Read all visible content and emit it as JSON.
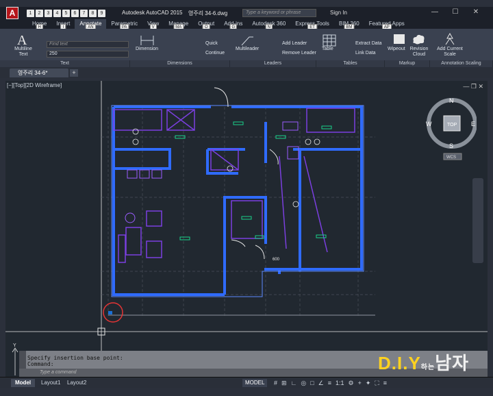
{
  "titlebar": {
    "logo": "A",
    "qat": [
      "1",
      "2",
      "3",
      "4",
      "5",
      "6",
      "7",
      "8",
      "9"
    ],
    "app_title": "Autodesk AutoCAD 2015",
    "file_name": "영주리 34-6.dwg",
    "search_placeholder": "Type a keyword or phrase",
    "signin": "Sign In",
    "minimize": "—",
    "maximize": "☐",
    "close": "✕"
  },
  "ribbon_tabs": [
    {
      "label": "Home",
      "key": "H"
    },
    {
      "label": "Insert",
      "key": "I"
    },
    {
      "label": "Annotate",
      "key": "AN"
    },
    {
      "label": "Parametric",
      "key": "PA"
    },
    {
      "label": "View",
      "key": "V"
    },
    {
      "label": "Manage",
      "key": "MA"
    },
    {
      "label": "Output",
      "key": "O"
    },
    {
      "label": "Add-ins",
      "key": "G"
    },
    {
      "label": "Autodesk 360",
      "key": "N"
    },
    {
      "label": "Express Tools",
      "key": "ET"
    },
    {
      "label": "BIM 360",
      "key": "BM"
    },
    {
      "label": "Featured Apps",
      "key": "AP"
    }
  ],
  "ribbon": {
    "multiline_text": "Multiline Text",
    "find_text_placeholder": "Find text",
    "text_height": "250",
    "dimension": "Dimension",
    "quick": "Quick",
    "continue": "Continue",
    "multileader": "Multileader",
    "add_leader": "Add Leader",
    "remove_leader": "Remove Leader",
    "table": "Table",
    "extract_data": "Extract Data",
    "link_data": "Link Data",
    "wipeout": "Wipeout",
    "revision_cloud": "Revision Cloud",
    "add_current_scale": "Add Current Scale",
    "panels": [
      "Text",
      "Dimensions",
      "Leaders",
      "Tables",
      "Markup",
      "Annotation Scaling"
    ]
  },
  "doc_tab": "영주리 34-6*",
  "viewport_label": "[−][Top][2D Wireframe]",
  "viewcube": {
    "top": "TOP",
    "n": "N",
    "s": "S",
    "e": "E",
    "w": "W",
    "wcs": "WCS"
  },
  "dimension_text": "600",
  "ucs_y": "Y",
  "command": {
    "history": [
      "Specify insertion base point:",
      "Command:"
    ],
    "placeholder": "Type a command"
  },
  "status": {
    "tabs": [
      "Model",
      "Layout1",
      "Layout2"
    ],
    "model_button": "MODEL",
    "scale": "1:1"
  },
  "watermark": {
    "dot": "D.I.Y",
    "mid": "하는",
    "end": "남자"
  },
  "colors": {
    "accent": "#1a6fd6",
    "walls": "#2f6bff",
    "furniture": "#7b3fe0",
    "labels": "#19d28a"
  }
}
